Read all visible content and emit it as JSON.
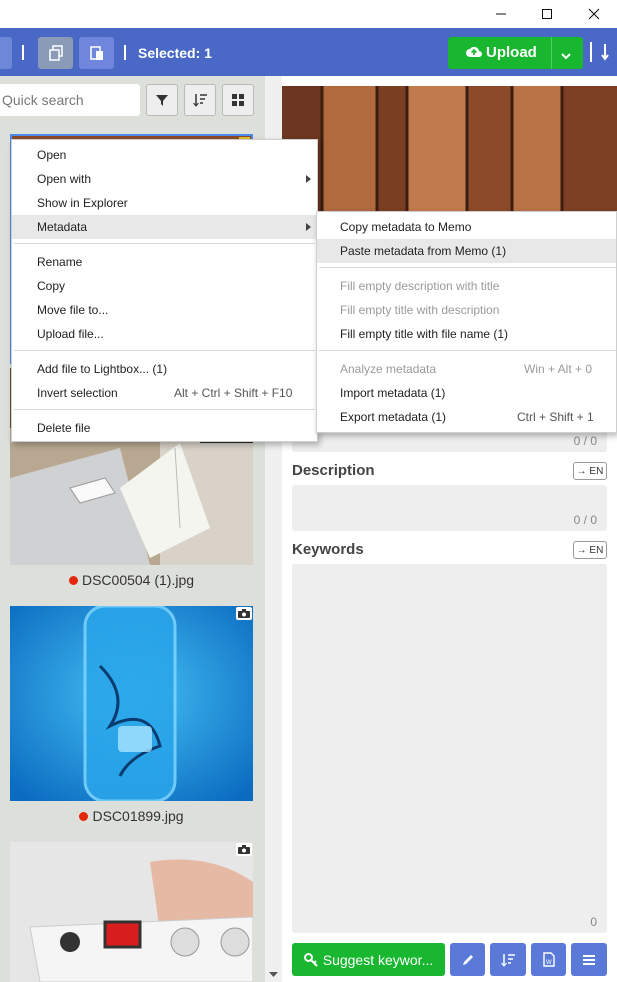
{
  "toolbar": {
    "selected_label": "Selected: 1",
    "upload_label": "Upload"
  },
  "left": {
    "search_placeholder": "Quick search",
    "files": [
      {
        "name": "DSC00504 (1).jpg",
        "status": "red"
      },
      {
        "name": "DSC01899.jpg",
        "status": "red"
      }
    ]
  },
  "context_menu": {
    "items": [
      "Open",
      "Open with",
      "Show in Explorer",
      "Metadata",
      "Rename",
      "Copy",
      "Move file to...",
      "Upload file...",
      "Add file to Lightbox... (1)",
      "Invert selection",
      "Delete file"
    ],
    "invert_shortcut": "Alt + Ctrl + Shift + F10"
  },
  "submenu": {
    "items": [
      "Copy metadata to Memo",
      "Paste metadata from Memo (1)",
      "Fill empty description with title",
      "Fill empty title with description",
      "Fill empty title with file name (1)",
      "Analyze metadata",
      "Import metadata (1)",
      "Export metadata (1)"
    ],
    "analyze_shortcut": "Win + Alt + 0",
    "export_shortcut": "Ctrl + Shift + 1"
  },
  "editor": {
    "title_count": "0 / 0",
    "description_label": "Description",
    "description_count": "0 / 0",
    "lang_badge": "→ EN",
    "keywords_label": "Keywords",
    "keywords_count": "0",
    "suggest_label": "Suggest keywor..."
  },
  "colors": {
    "toolbar": "#4a68c5",
    "upload": "#18b72f",
    "status_dot": "#e2270a",
    "panel": "#dde0da"
  },
  "icons": [
    "minimize-icon",
    "maximize-icon",
    "close-icon",
    "copy-icon",
    "paste-icon",
    "cloud-upload-icon",
    "chevron-down-icon",
    "filter-icon",
    "sort-icon",
    "grid-icon",
    "camera-icon",
    "key-icon",
    "pencil-icon",
    "word-icon",
    "menu-icon"
  ]
}
